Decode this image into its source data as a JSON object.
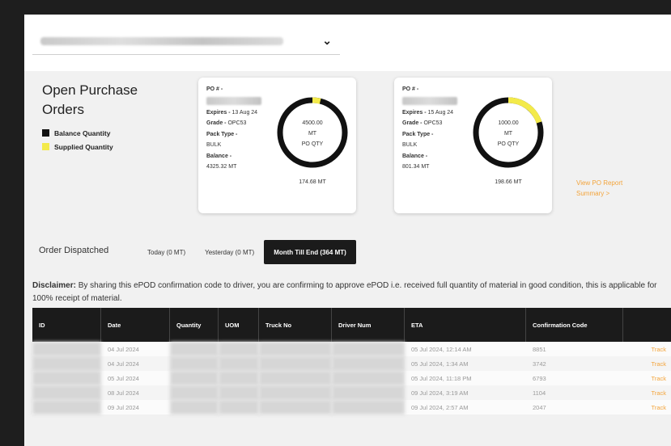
{
  "selector": {
    "chevron": "⌄"
  },
  "open_po": {
    "title": "Open Purchase Orders",
    "legend": [
      {
        "label": "Balance Quantity",
        "color": "#111111"
      },
      {
        "label": "Supplied Quantity",
        "color": "#f3ea4a"
      }
    ],
    "cards": [
      {
        "po_label": "PO # -",
        "expires_label": "Expires -",
        "expires_value": "13 Aug 24",
        "grade_label": "Grade -",
        "grade_value": "OPC53",
        "pack_label": "Pack Type -",
        "pack_value": "BULK",
        "balance_label": "Balance -",
        "balance_value": "4325.32 MT",
        "po_qty": "4500.00",
        "unit": "MT",
        "qty_label": "PO QTY",
        "supplied": "174.68 MT",
        "supplied_fraction": 0.039
      },
      {
        "po_label": "PO # -",
        "expires_label": "Expires -",
        "expires_value": "15 Aug 24",
        "grade_label": "Grade -",
        "grade_value": "OPC53",
        "pack_label": "Pack Type -",
        "pack_value": "BULK",
        "balance_label": "Balance -",
        "balance_value": "801.34 MT",
        "po_qty": "1000.00",
        "unit": "MT",
        "qty_label": "PO QTY",
        "supplied": "198.66 MT",
        "supplied_fraction": 0.199
      }
    ],
    "report_link": "View PO Report Summary >"
  },
  "dispatch": {
    "label": "Order Dispatched",
    "tabs": [
      "Today (0 MT)",
      "Yesterday (0 MT)",
      "Month Till End (364 MT)"
    ],
    "active_tab": 2
  },
  "disclaimer": {
    "bold": "Disclaimer:",
    "text": " By sharing this ePOD confirmation code to driver, you are confirming to approve ePOD i.e. received full quantity of material in good condition, this is applicable for 100% receipt of material."
  },
  "table": {
    "headers": [
      "ID",
      "Date",
      "Quantity",
      "UOM",
      "Truck No",
      "Driver Num",
      "ETA",
      "Confirmation Code",
      ""
    ],
    "rows": [
      {
        "date": "04 Jul 2024",
        "eta": "05 Jul 2024, 12:14 AM",
        "code": "8851",
        "action": "Track"
      },
      {
        "date": "04 Jul 2024",
        "eta": "05 Jul 2024, 1:34 AM",
        "code": "3742",
        "action": "Track"
      },
      {
        "date": "05 Jul 2024",
        "eta": "05 Jul 2024, 11:18 PM",
        "code": "6793",
        "action": "Track"
      },
      {
        "date": "08 Jul 2024",
        "eta": "09 Jul 2024, 3:19 AM",
        "code": "1104",
        "action": "Track"
      },
      {
        "date": "09 Jul 2024",
        "eta": "09 Jul 2024, 2:57 AM",
        "code": "2047",
        "action": "Track"
      }
    ]
  }
}
